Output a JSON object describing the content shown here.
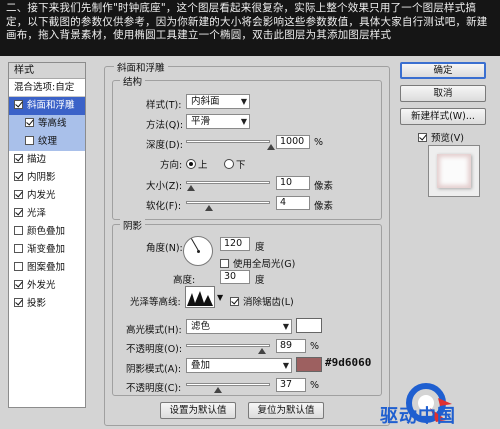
{
  "banner": {
    "text": "二、接下来我们先制作\"时钟底座\"，这个图层看起来很复杂，实际上整个效果只用了一个图层样式搞定，以下截图的参数仅供参考，因为你新建的大小将会影响这些参数数值，具体大家自行测试吧，新建画布，拖入背景素材，使用椭圆工具建立一个椭圆，双击此图层为其添加图层样式"
  },
  "left_panel": {
    "title": "样式",
    "blend_label": "混合选项:自定",
    "items": [
      {
        "label": "斜面和浮雕",
        "checked": true
      },
      {
        "label": "等高线",
        "checked": true
      },
      {
        "label": "纹理",
        "checked": false
      },
      {
        "label": "描边",
        "checked": true
      },
      {
        "label": "内阴影",
        "checked": true
      },
      {
        "label": "内发光",
        "checked": true
      },
      {
        "label": "光泽",
        "checked": true
      },
      {
        "label": "颜色叠加",
        "checked": false
      },
      {
        "label": "渐变叠加",
        "checked": false
      },
      {
        "label": "图案叠加",
        "checked": false
      },
      {
        "label": "外发光",
        "checked": true
      },
      {
        "label": "投影",
        "checked": true
      }
    ]
  },
  "bevel": {
    "group_title": "斜面和浮雕",
    "structure_title": "结构",
    "style_label": "样式(T):",
    "style_value": "内斜面",
    "technique_label": "方法(Q):",
    "technique_value": "平滑",
    "depth_label": "深度(D):",
    "depth_value": "1000",
    "depth_unit": "%",
    "direction_label": "方向:",
    "direction_up": "上",
    "direction_down": "下",
    "size_label": "大小(Z):",
    "size_value": "10",
    "size_unit": "像素",
    "soften_label": "软化(F):",
    "soften_value": "4",
    "soften_unit": "像素"
  },
  "shading": {
    "title": "阴影",
    "angle_label": "角度(N):",
    "angle_value": "120",
    "angle_unit": "度",
    "global_light_label": "使用全局光(G)",
    "altitude_label": "高度:",
    "altitude_value": "30",
    "altitude_unit": "度",
    "gloss_label": "光泽等高线:",
    "antialias_label": "消除锯齿(L)",
    "highlight_label": "高光模式(H):",
    "highlight_mode": "滤色",
    "highlight_color": "#ffffff",
    "highlight_opacity_label": "不透明度(O):",
    "highlight_opacity": "89",
    "shadow_label": "阴影模式(A):",
    "shadow_mode": "叠加",
    "shadow_color": "#9d6060",
    "shadow_color_text": "#9d6060",
    "shadow_opacity_label": "不透明度(C):",
    "shadow_opacity": "37",
    "percent": "%"
  },
  "buttons": {
    "ok": "确定",
    "cancel": "取消",
    "new_style": "新建样式(W)...",
    "preview": "预览(V)",
    "make_default": "设置为默认值",
    "reset_default": "复位为默认值"
  },
  "watermark": {
    "text": "驱动中国"
  },
  "colors": {
    "selection": "#3b62c8",
    "logo_blue": "#1f5fd0",
    "logo_red": "#e03030"
  }
}
